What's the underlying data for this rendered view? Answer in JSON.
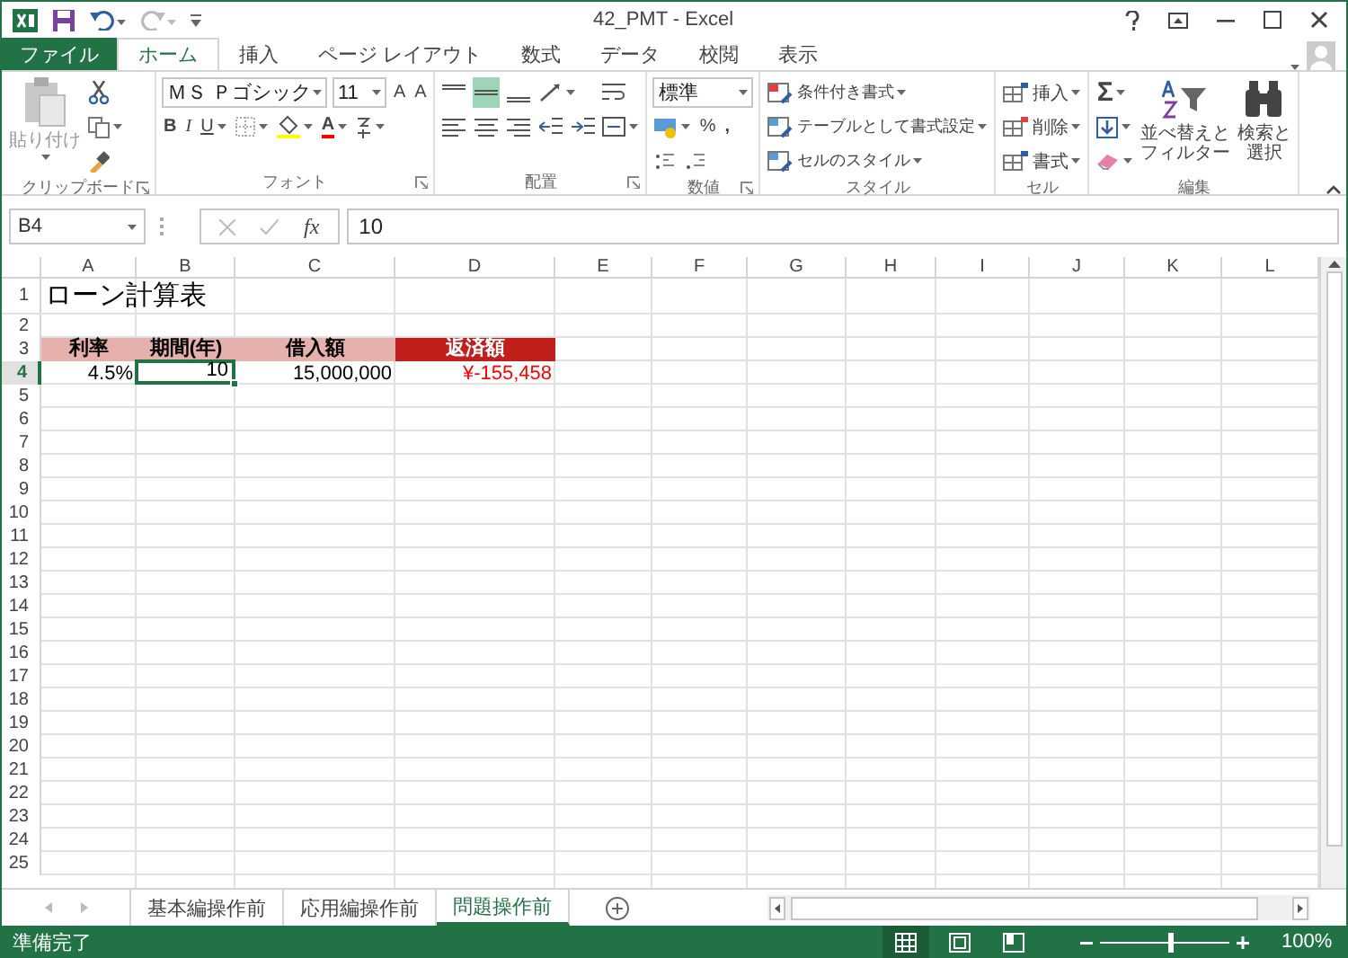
{
  "window": {
    "title": "42_PMT - Excel"
  },
  "ribbon_tabs": [
    {
      "label": "ファイル",
      "kind": "file",
      "selected": false
    },
    {
      "label": "ホーム",
      "kind": "tab",
      "selected": true
    },
    {
      "label": "挿入",
      "kind": "tab",
      "selected": false
    },
    {
      "label": "ページ レイアウト",
      "kind": "tab",
      "selected": false
    },
    {
      "label": "数式",
      "kind": "tab",
      "selected": false
    },
    {
      "label": "データ",
      "kind": "tab",
      "selected": false
    },
    {
      "label": "校閲",
      "kind": "tab",
      "selected": false
    },
    {
      "label": "表示",
      "kind": "tab",
      "selected": false
    }
  ],
  "ribbon": {
    "groups": [
      {
        "kind": "clipboard",
        "label": "クリップボード",
        "paste": "貼り付け"
      },
      {
        "kind": "font",
        "label": "フォント",
        "font_name": "ＭＳ Ｐゴシック",
        "font_size": "11",
        "grow": "A",
        "shrink": "A",
        "bold": "B",
        "italic": "I",
        "underline": "U",
        "font_color": "A"
      },
      {
        "kind": "alignment",
        "label": "配置",
        "vertical": [
          {
            "selected": false
          },
          {
            "selected": true
          },
          {
            "selected": false
          }
        ]
      },
      {
        "kind": "number",
        "label": "数値",
        "format": "標準",
        "percent": "%",
        "comma": ","
      },
      {
        "kind": "styles",
        "label": "スタイル",
        "items": [
          "条件付き書式",
          "テーブルとして書式設定",
          "セルのスタイル"
        ]
      },
      {
        "kind": "cells",
        "label": "セル",
        "items": [
          "挿入",
          "削除",
          "書式"
        ]
      },
      {
        "kind": "editing",
        "label": "編集",
        "sum": "Σ",
        "sort": "並べ替えとフィルター",
        "find": "検索と選択"
      }
    ]
  },
  "formula_bar": {
    "name_box": "B4",
    "function_label": "fx",
    "value": "10"
  },
  "sheet": {
    "columns": [
      "A",
      "B",
      "C",
      "D",
      "E",
      "F",
      "G",
      "H",
      "I",
      "J",
      "K",
      "L"
    ],
    "rows": [
      {
        "number": "1",
        "cells": [
          {
            "text": "ローン計算表",
            "kind": "title"
          }
        ]
      },
      {
        "number": "2"
      },
      {
        "number": "3",
        "cells": [
          {
            "text": "利率",
            "kind": "header"
          },
          {
            "text": "期間(年)",
            "kind": "header"
          },
          {
            "text": "借入額",
            "kind": "header"
          },
          {
            "text": "返済額",
            "kind": "header-dark"
          }
        ]
      },
      {
        "number": "4",
        "cells": [
          {
            "text": "4.5%",
            "kind": "number",
            "selected": false
          },
          {
            "text": "10",
            "kind": "number",
            "selected": true
          },
          {
            "text": "15,000,000",
            "kind": "number",
            "selected": false
          },
          {
            "text": "¥-155,458",
            "kind": "negative",
            "selected": false
          }
        ]
      },
      {
        "number": "5"
      },
      {
        "number": "6"
      },
      {
        "number": "7"
      },
      {
        "number": "8"
      },
      {
        "number": "9"
      },
      {
        "number": "10"
      },
      {
        "number": "11"
      },
      {
        "number": "12"
      },
      {
        "number": "13"
      },
      {
        "number": "14"
      },
      {
        "number": "15"
      },
      {
        "number": "16"
      },
      {
        "number": "17"
      },
      {
        "number": "18"
      },
      {
        "number": "19"
      },
      {
        "number": "20"
      },
      {
        "number": "21"
      },
      {
        "number": "22"
      },
      {
        "number": "23"
      },
      {
        "number": "24"
      },
      {
        "number": "25"
      }
    ]
  },
  "sheet_tabs": [
    {
      "label": "基本編操作前",
      "selected": false
    },
    {
      "label": "応用編操作前",
      "selected": false
    },
    {
      "label": "問題操作前",
      "selected": true
    }
  ],
  "status_bar": {
    "text": "準備完了",
    "views": [
      {
        "selected": true
      },
      {
        "selected": false
      },
      {
        "selected": false
      }
    ],
    "zoom": {
      "level": 0.55,
      "reading": "100%"
    }
  }
}
